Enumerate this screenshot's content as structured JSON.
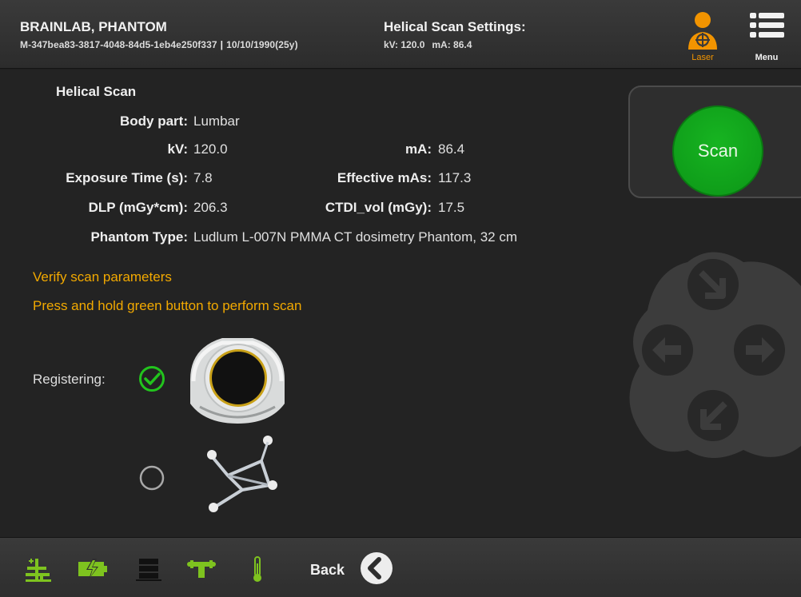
{
  "header": {
    "patient_name": "BRAINLAB, PHANTOM",
    "patient_id": "M-347bea83-3817-4048-84d5-1eb4e250f337",
    "separator": "|",
    "patient_dob": "10/10/1990(25y)",
    "scan_settings_title": "Helical Scan Settings:",
    "kv_text": "kV:  120.0",
    "ma_text": "mA:  86.4",
    "laser_label": "Laser",
    "menu_label": "Menu",
    "accent_color": "#f29400"
  },
  "scan_info": {
    "title": "Helical Scan",
    "body_part_label": "Body part:",
    "body_part_value": "Lumbar",
    "kv_label": "kV:",
    "kv_value": "120.0",
    "ma_label": "mA:",
    "ma_value": "86.4",
    "exposure_label": "Exposure Time (s):",
    "exposure_value": "7.8",
    "effective_mas_label": "Effective mAs:",
    "effective_mas_value": "117.3",
    "dlp_label": "DLP (mGy*cm):",
    "dlp_value": "206.3",
    "ctdi_label": "CTDI_vol (mGy):",
    "ctdi_value": "17.5",
    "phantom_type_label": "Phantom Type:",
    "phantom_type_value": "Ludlum L-007N PMMA CT dosimetry Phantom, 32 cm"
  },
  "notices": {
    "verify": "Verify scan parameters",
    "press_hold": "Press and hold green button to perform scan",
    "color": "#f2a900"
  },
  "registration": {
    "label": "Registering:",
    "items": [
      {
        "icon": "ring-device-icon",
        "status": "done"
      },
      {
        "icon": "marker-array-icon",
        "status": "pending"
      }
    ]
  },
  "scan_button": {
    "label": "Scan",
    "color": "#14a71d"
  },
  "dpad": {
    "icons": [
      "arrow-down-right-icon",
      "arrow-left-icon",
      "arrow-right-icon",
      "arrow-down-left-icon"
    ]
  },
  "footer": {
    "icons": [
      "laser-alignment-icon",
      "battery-charging-icon",
      "server-icon",
      "table-icon",
      "thermometer-icon"
    ],
    "icon_color": "#7ec31f",
    "back_label": "Back"
  }
}
